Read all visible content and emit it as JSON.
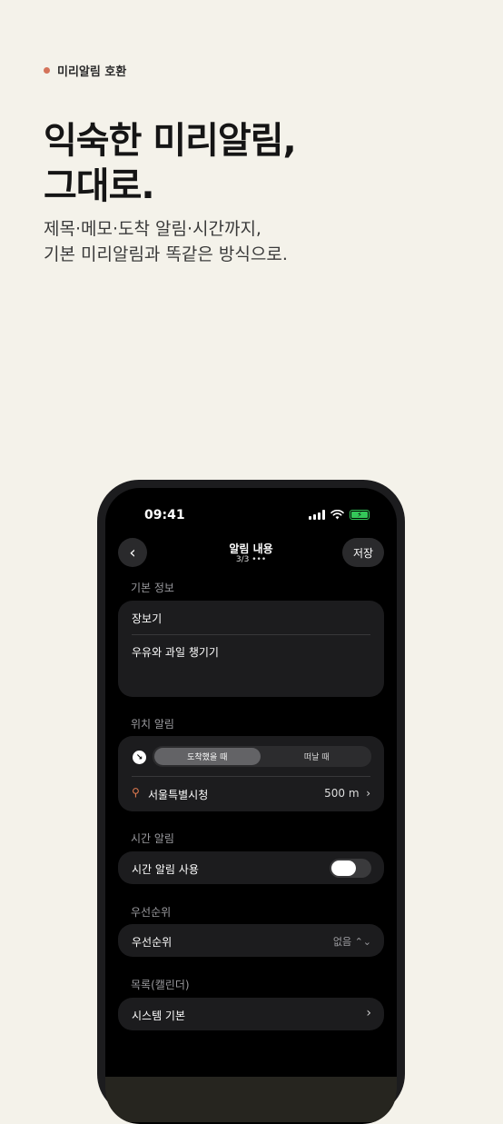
{
  "eyebrow": "미리알림 호환",
  "headline": {
    "line1": "익숙한 미리알림,",
    "line2": "그대로."
  },
  "subtitle": {
    "line1": "제목·메모·도착 알림·시간까지,",
    "line2": "기본 미리알림과 똑같은 방식으로."
  },
  "status": {
    "time": "09:41"
  },
  "nav": {
    "back_icon": "‹",
    "title": "알림 내용",
    "subtitle": "3/3 •••",
    "save": "저장"
  },
  "basic": {
    "label": "기본 정보",
    "title": "장보기",
    "memo": "우유와 과일 챙기기"
  },
  "location": {
    "label": "위치 알림",
    "options": [
      "도착했을 때",
      "떠날 때"
    ],
    "selected": 0,
    "place": "서울특별시청",
    "distance": "500 m",
    "chevron": "›"
  },
  "time": {
    "label": "시간 알림",
    "row": "시간 알림 사용",
    "enabled": false
  },
  "priority": {
    "label": "우선순위",
    "row": "우선순위",
    "value": "없음 ⌃⌄"
  },
  "list": {
    "label": "목록(캘린더)",
    "row": "시스템 기본",
    "chevron": "›"
  },
  "colors": {
    "accent": "#d4735a",
    "battery": "#34c759",
    "background": "#f4f2ea"
  }
}
